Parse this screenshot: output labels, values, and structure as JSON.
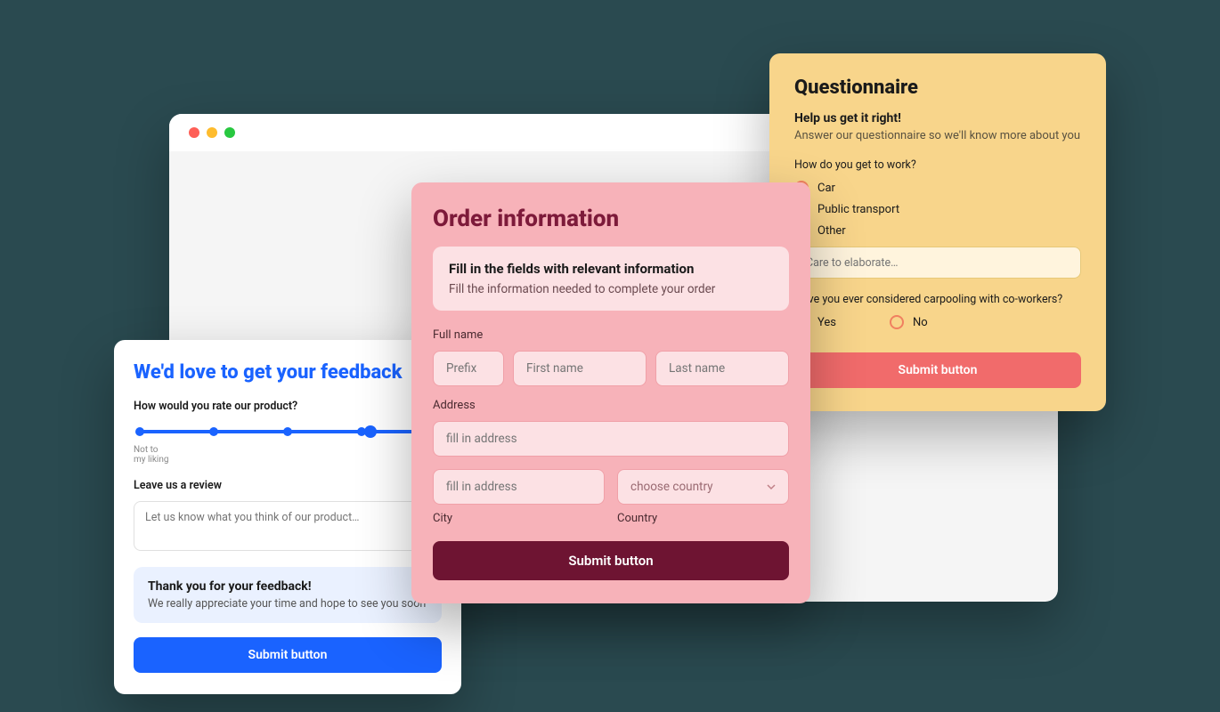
{
  "questionnaire": {
    "title": "Questionnaire",
    "subtitle": "Help us get it right!",
    "desc": "Answer our questionnaire so we'll know more about you",
    "q1": "How do you get to work?",
    "options": [
      "Car",
      "Public transport",
      "Other"
    ],
    "elaborate_placeholder": "Care to elaborate…",
    "q2": "Have you ever considered carpooling with co-workers?",
    "yes": "Yes",
    "no": "No",
    "submit": "Submit button"
  },
  "order": {
    "title": "Order information",
    "box_title": "Fill in the fields with relevant information",
    "box_desc": "Fill the information needed to complete your order",
    "full_name_label": "Full name",
    "prefix_ph": "Prefix",
    "first_ph": "First name",
    "last_ph": "Last name",
    "address_label": "Address",
    "addr_ph": "fill in address",
    "country_ph": "choose country",
    "city_label": "City",
    "country_label": "Country",
    "submit": "Submit button"
  },
  "feedback": {
    "title": "We'd love to get your feedback",
    "q1": "How would you rate our product?",
    "scale_low": "Not to\nmy liking",
    "review_label": "Leave us a review",
    "review_ph": "Let us know what you think of our product…",
    "ty_title": "Thank you for your feedback!",
    "ty_desc": "We really appreciate your time and hope to see you soon",
    "submit": "Submit button"
  }
}
